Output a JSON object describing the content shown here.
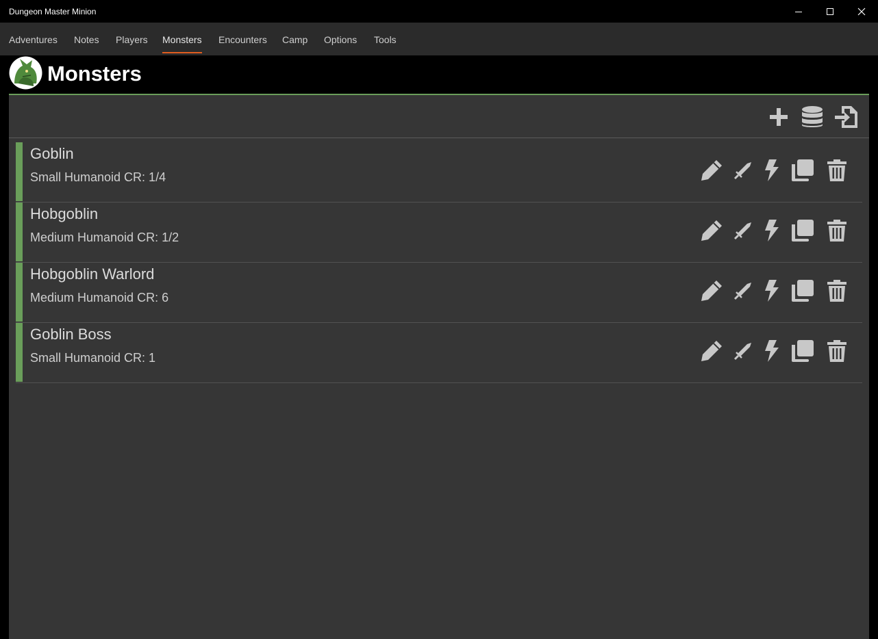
{
  "window": {
    "title": "Dungeon Master Minion",
    "controls": [
      "minimize-icon",
      "maximize-icon",
      "close-icon"
    ]
  },
  "menu": {
    "items": [
      {
        "label": "Adventures"
      },
      {
        "label": "Notes"
      },
      {
        "label": "Players"
      },
      {
        "label": "Monsters",
        "active": true
      },
      {
        "label": "Encounters"
      },
      {
        "label": "Camp"
      },
      {
        "label": "Options"
      },
      {
        "label": "Tools"
      }
    ]
  },
  "page": {
    "title": "Monsters",
    "logo_icon": "dragon-logo-icon"
  },
  "toolbar": {
    "buttons": [
      "plus-icon",
      "database-icon",
      "import-file-icon"
    ]
  },
  "monsters": [
    {
      "name": "Goblin",
      "subtitle": "Small Humanoid CR: 1/4"
    },
    {
      "name": "Hobgoblin",
      "subtitle": "Medium Humanoid CR: 1/2"
    },
    {
      "name": "Hobgoblin Warlord",
      "subtitle": "Medium Humanoid CR: 6"
    },
    {
      "name": "Goblin Boss",
      "subtitle": "Small Humanoid CR: 1"
    }
  ],
  "row_actions": [
    "pencil-icon",
    "sword-icon",
    "lightning-icon",
    "copy-icon",
    "trash-icon"
  ],
  "colors": {
    "accent_green": "#6a9e5a",
    "menu_underline": "#e05d1f",
    "panel_bg": "#363636",
    "icon_gray": "#c8c8c8"
  }
}
